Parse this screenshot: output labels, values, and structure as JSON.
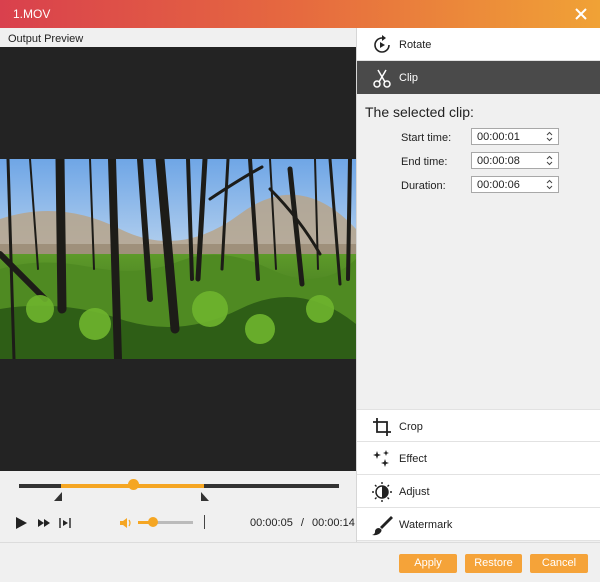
{
  "window": {
    "title": "1.MOV",
    "accent": "#f5a623"
  },
  "preview": {
    "label": "Output Preview"
  },
  "player": {
    "current_time": "00:00:05",
    "separator": "/",
    "total_time": "00:00:14"
  },
  "tools": {
    "rotate": "Rotate",
    "clip": "Clip",
    "crop": "Crop",
    "effect": "Effect",
    "adjust": "Adjust",
    "watermark": "Watermark"
  },
  "clip": {
    "heading": "The selected clip:",
    "start_label": "Start time:",
    "start_value": "00:00:01",
    "end_label": "End time:",
    "end_value": "00:00:08",
    "duration_label": "Duration:",
    "duration_value": "00:00:06"
  },
  "footer": {
    "apply": "Apply",
    "restore": "Restore",
    "cancel": "Cancel"
  }
}
